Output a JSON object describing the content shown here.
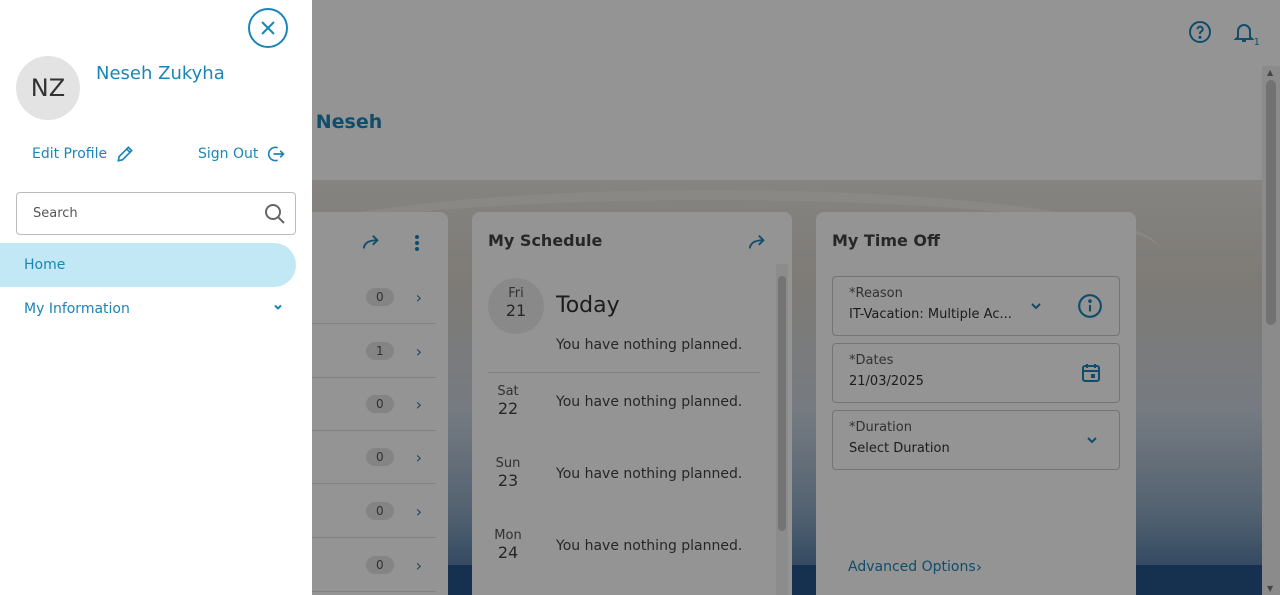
{
  "header": {
    "help_icon": "question-circle-icon",
    "notification_icon": "bell-icon",
    "notification_count": "1"
  },
  "welcome": {
    "text": "ck, Neseh"
  },
  "tasks_card": {
    "counts": [
      "0",
      "1",
      "0",
      "0",
      "0",
      "0"
    ]
  },
  "schedule": {
    "title": "My Schedule",
    "today": {
      "dow": "Fri",
      "day": "21",
      "label": "Today",
      "message": "You have nothing planned."
    },
    "days": [
      {
        "dow": "Sat",
        "day": "22",
        "message": "You have nothing planned."
      },
      {
        "dow": "Sun",
        "day": "23",
        "message": "You have nothing planned."
      },
      {
        "dow": "Mon",
        "day": "24",
        "message": "You have nothing planned."
      }
    ]
  },
  "time_off": {
    "title": "My Time Off",
    "required_mark": "*",
    "reason": {
      "label": "Reason",
      "value": "IT-Vacation: Multiple Ac..."
    },
    "dates": {
      "label": "Dates",
      "value": "21/03/2025"
    },
    "duration": {
      "label": "Duration",
      "value": "Select Duration"
    },
    "advanced_options": "Advanced Options"
  },
  "drawer": {
    "avatar_initials": "NZ",
    "user_name": "Neseh Zukyha",
    "edit_profile": "Edit Profile",
    "sign_out": "Sign Out",
    "search": {
      "placeholder": "Search",
      "value": ""
    },
    "nav": {
      "home": "Home",
      "my_information": "My Information"
    }
  },
  "colors": {
    "accent": "#1a86b8",
    "active_nav_bg": "#c2e8f5",
    "overlay": "rgba(0,0,0,0.42)"
  }
}
